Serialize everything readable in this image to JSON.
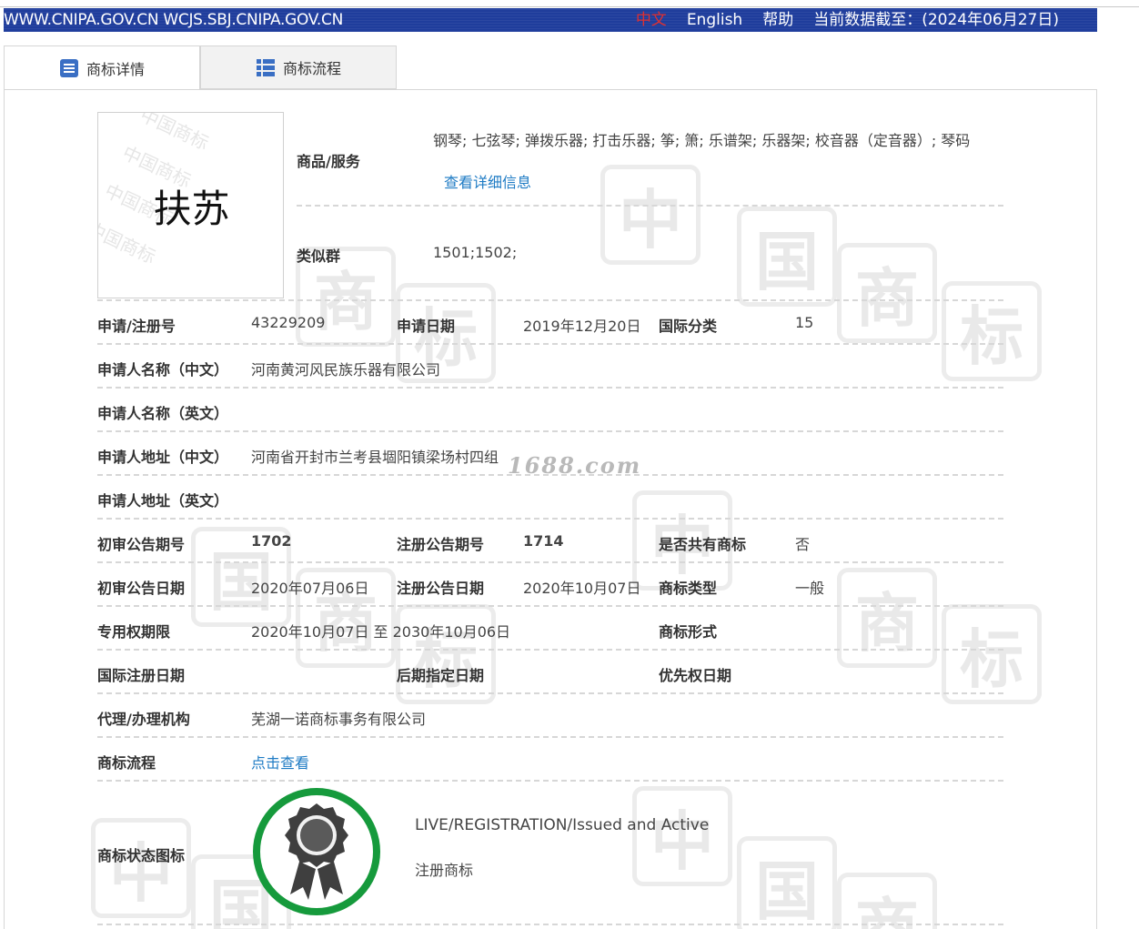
{
  "topbar": {
    "sites": "WWW.CNIPA.GOV.CN WCJS.SBJ.CNIPA.GOV.CN",
    "lang_zh": "中文",
    "lang_en": "English",
    "help": "帮助",
    "data_as_of": "当前数据截至：(2024年06月27日)"
  },
  "tabs": [
    {
      "label": "商标详情",
      "icon": "document-list-icon",
      "active": true
    },
    {
      "label": "商标流程",
      "icon": "list-icon",
      "active": false
    }
  ],
  "trademark": {
    "image_text": "扶苏",
    "watermark_text": "中国商标"
  },
  "goods": {
    "label": "商品/服务",
    "value": "钢琴; 七弦琴; 弹拨乐器; 打击乐器; 筝; 箫; 乐谱架; 乐器架; 校音器（定音器）; 琴码",
    "detail_link": "查看详细信息"
  },
  "similar": {
    "label": "类似群",
    "value": "1501;1502;"
  },
  "rows": {
    "reg_no": {
      "label": "申请/注册号",
      "value": "43229209"
    },
    "app_date": {
      "label": "申请日期",
      "value": "2019年12月20日"
    },
    "intl_class": {
      "label": "国际分类",
      "value": "15"
    },
    "applicant_cn": {
      "label": "申请人名称（中文）",
      "value": "河南黄河风民族乐器有限公司"
    },
    "applicant_en": {
      "label": "申请人名称（英文）",
      "value": ""
    },
    "address_cn": {
      "label": "申请人地址（中文）",
      "value": "河南省开封市兰考县堌阳镇梁场村四组"
    },
    "address_en": {
      "label": "申请人地址（英文）",
      "value": ""
    },
    "prelim_no": {
      "label": "初审公告期号",
      "value": "1702"
    },
    "reg_pub_no": {
      "label": "注册公告期号",
      "value": "1714"
    },
    "shared": {
      "label": "是否共有商标",
      "value": "否"
    },
    "prelim_date": {
      "label": "初审公告日期",
      "value": "2020年07月06日"
    },
    "reg_pub_date": {
      "label": "注册公告日期",
      "value": "2020年10月07日"
    },
    "tm_type": {
      "label": "商标类型",
      "value": "一般"
    },
    "exclusive": {
      "label": "专用权期限",
      "value": "2020年10月07日 至 2030年10月06日"
    },
    "tm_form": {
      "label": "商标形式",
      "value": ""
    },
    "intl_reg_date": {
      "label": "国际注册日期",
      "value": ""
    },
    "later_date": {
      "label": "后期指定日期",
      "value": ""
    },
    "priority_date": {
      "label": "优先权日期",
      "value": ""
    },
    "agent": {
      "label": "代理/办理机构",
      "value": "芜湖一诺商标事务有限公司"
    },
    "flow": {
      "label": "商标流程",
      "link": "点击查看"
    },
    "status": {
      "label": "商标状态图标",
      "status_en": "LIVE/REGISTRATION/Issued and Active",
      "status_cn": "注册商标"
    }
  },
  "overlay_watermark": "1688.com",
  "colors": {
    "topbar": "#1f3d9c",
    "link": "#1e7bc4",
    "status_ring": "#169a3c",
    "medal": "#3f3f3f"
  }
}
